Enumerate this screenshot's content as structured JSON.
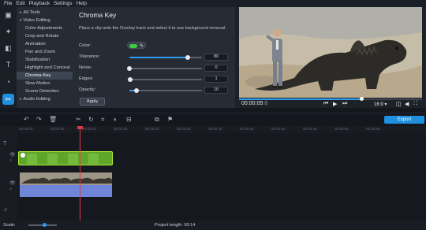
{
  "menu": [
    "File",
    "Edit",
    "Playback",
    "Settings",
    "Help"
  ],
  "sidebar": {
    "items": [
      {
        "label": "All Tools",
        "arrow": "▸"
      },
      {
        "label": "Video Editing",
        "arrow": "▾"
      },
      {
        "label": "Color Adjustments"
      },
      {
        "label": "Crop and Rotate"
      },
      {
        "label": "Animation"
      },
      {
        "label": "Pan and Zoom"
      },
      {
        "label": "Stabilization"
      },
      {
        "label": "Highlight and Conceal"
      },
      {
        "label": "Chroma Key"
      },
      {
        "label": "Slow Motion"
      },
      {
        "label": "Scene Detection"
      },
      {
        "label": "Audio Editing",
        "arrow": "▸"
      }
    ]
  },
  "panel": {
    "title": "Chroma Key",
    "description": "Place a clip onto the Overlay track and select it to use background removal.",
    "color_label": "Color:",
    "color_value": "#3ecb3e",
    "params": [
      {
        "label": "Tolerance:",
        "value": "80",
        "level": 0.8
      },
      {
        "label": "Noise:",
        "value": "0",
        "level": 0.0
      },
      {
        "label": "Edges:",
        "value": "1",
        "level": 0.01
      },
      {
        "label": "Opacity:",
        "value": "10",
        "level": 0.1
      }
    ],
    "apply_label": "Apply"
  },
  "player": {
    "time": "00:00:09",
    "time_frac": "8",
    "aspect": "16:9 ▾",
    "progress": 0.67
  },
  "export_label": "Export",
  "ruler": [
    "00:00:00",
    "00:00:05",
    "00:00:10",
    "00:00:15",
    "00:00:20",
    "00:00:25",
    "00:00:30",
    "00:00:35",
    "00:00:40",
    "00:00:45",
    "00:00:50",
    "00:00:55"
  ],
  "status": {
    "scale_label": "Scale:",
    "project_length_label": "Project length:",
    "project_length": "00:14"
  },
  "colors": {
    "accent": "#1f8fe0",
    "chroma_green": "#5ea62a",
    "playhead": "#e0384a",
    "audio": "#6f86d8"
  }
}
